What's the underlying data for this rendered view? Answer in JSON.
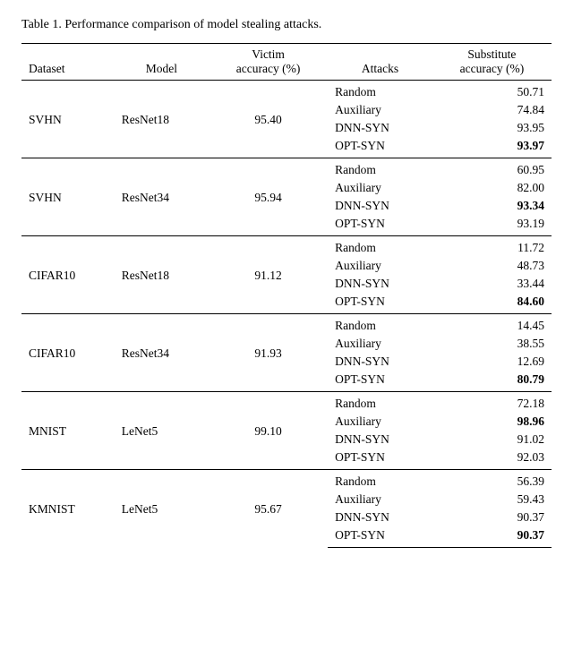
{
  "title": "Table 1. Performance comparison of model stealing attacks.",
  "columns": [
    "Dataset",
    "Model",
    "Victim\naccuracy (%)",
    "Attacks",
    "Substitute\naccuracy (%)"
  ],
  "groups": [
    {
      "dataset": "SVHN",
      "model": "ResNet18",
      "victim_acc": "95.40",
      "rows": [
        {
          "attack": "Random",
          "sub_acc": "50.71",
          "bold": false
        },
        {
          "attack": "Auxiliary",
          "sub_acc": "74.84",
          "bold": false
        },
        {
          "attack": "DNN-SYN",
          "sub_acc": "93.95",
          "bold": false
        },
        {
          "attack": "OPT-SYN",
          "sub_acc": "93.97",
          "bold": true
        }
      ]
    },
    {
      "dataset": "SVHN",
      "model": "ResNet34",
      "victim_acc": "95.94",
      "rows": [
        {
          "attack": "Random",
          "sub_acc": "60.95",
          "bold": false
        },
        {
          "attack": "Auxiliary",
          "sub_acc": "82.00",
          "bold": false
        },
        {
          "attack": "DNN-SYN",
          "sub_acc": "93.34",
          "bold": true
        },
        {
          "attack": "OPT-SYN",
          "sub_acc": "93.19",
          "bold": false
        }
      ]
    },
    {
      "dataset": "CIFAR10",
      "model": "ResNet18",
      "victim_acc": "91.12",
      "rows": [
        {
          "attack": "Random",
          "sub_acc": "11.72",
          "bold": false
        },
        {
          "attack": "Auxiliary",
          "sub_acc": "48.73",
          "bold": false
        },
        {
          "attack": "DNN-SYN",
          "sub_acc": "33.44",
          "bold": false
        },
        {
          "attack": "OPT-SYN",
          "sub_acc": "84.60",
          "bold": true
        }
      ]
    },
    {
      "dataset": "CIFAR10",
      "model": "ResNet34",
      "victim_acc": "91.93",
      "rows": [
        {
          "attack": "Random",
          "sub_acc": "14.45",
          "bold": false
        },
        {
          "attack": "Auxiliary",
          "sub_acc": "38.55",
          "bold": false
        },
        {
          "attack": "DNN-SYN",
          "sub_acc": "12.69",
          "bold": false
        },
        {
          "attack": "OPT-SYN",
          "sub_acc": "80.79",
          "bold": true
        }
      ]
    },
    {
      "dataset": "MNIST",
      "model": "LeNet5",
      "victim_acc": "99.10",
      "rows": [
        {
          "attack": "Random",
          "sub_acc": "72.18",
          "bold": false
        },
        {
          "attack": "Auxiliary",
          "sub_acc": "98.96",
          "bold": true
        },
        {
          "attack": "DNN-SYN",
          "sub_acc": "91.02",
          "bold": false
        },
        {
          "attack": "OPT-SYN",
          "sub_acc": "92.03",
          "bold": false
        }
      ]
    },
    {
      "dataset": "KMNIST",
      "model": "LeNet5",
      "victim_acc": "95.67",
      "rows": [
        {
          "attack": "Random",
          "sub_acc": "56.39",
          "bold": false
        },
        {
          "attack": "Auxiliary",
          "sub_acc": "59.43",
          "bold": false
        },
        {
          "attack": "DNN-SYN",
          "sub_acc": "90.37",
          "bold": false
        },
        {
          "attack": "OPT-SYN",
          "sub_acc": "90.37",
          "bold": true
        }
      ]
    }
  ]
}
